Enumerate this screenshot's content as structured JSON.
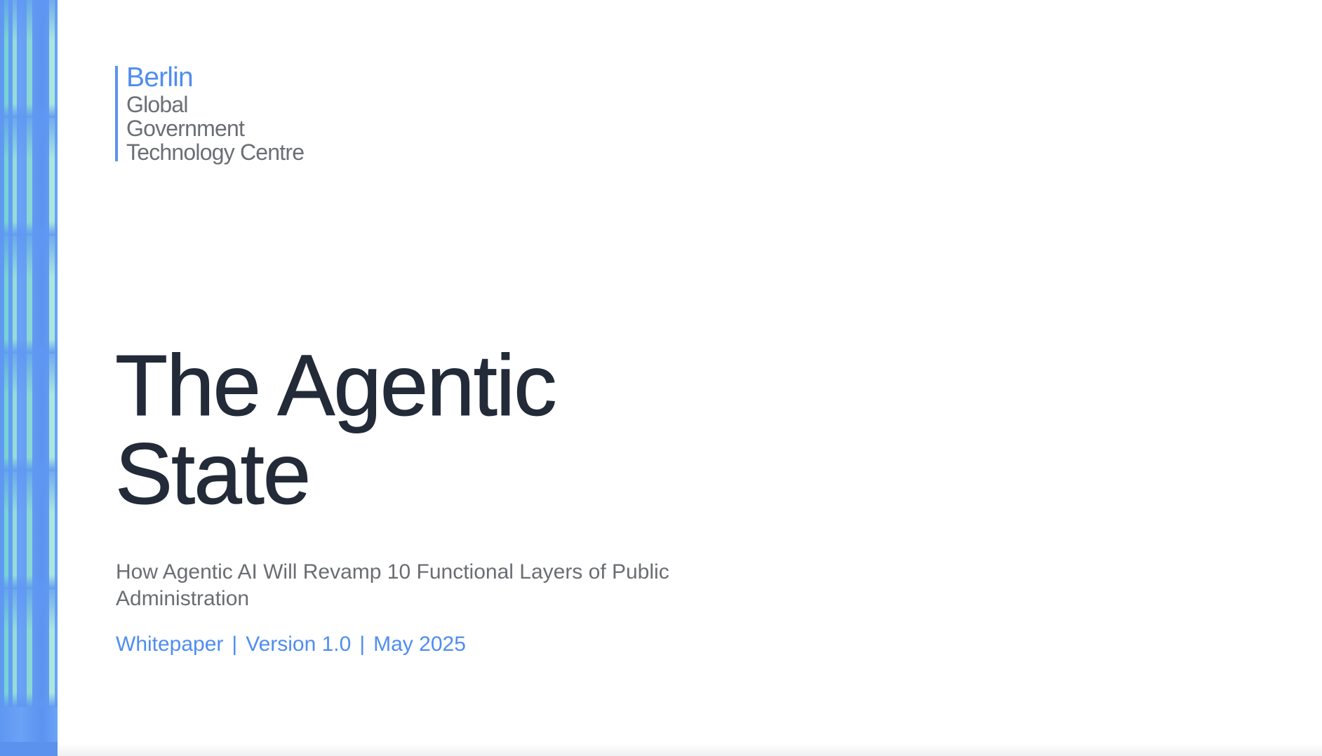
{
  "logo": {
    "city": "Berlin",
    "line1": "Global",
    "line2": "Government",
    "line3": "Technology Centre"
  },
  "title": {
    "line1": "The Agentic",
    "line2": "State"
  },
  "subtitle": "How Agentic AI Will Revamp 10 Functional Layers of Public Administration",
  "meta": {
    "type": "Whitepaper",
    "version": "Version 1.0",
    "date": "May 2025",
    "separator": "|"
  },
  "colors": {
    "accent": "#4f8df0",
    "title": "#232a38",
    "body_text": "#6a6d72",
    "stripe_blue": "#5f98f2",
    "stripe_teal": "#8edcd2"
  }
}
